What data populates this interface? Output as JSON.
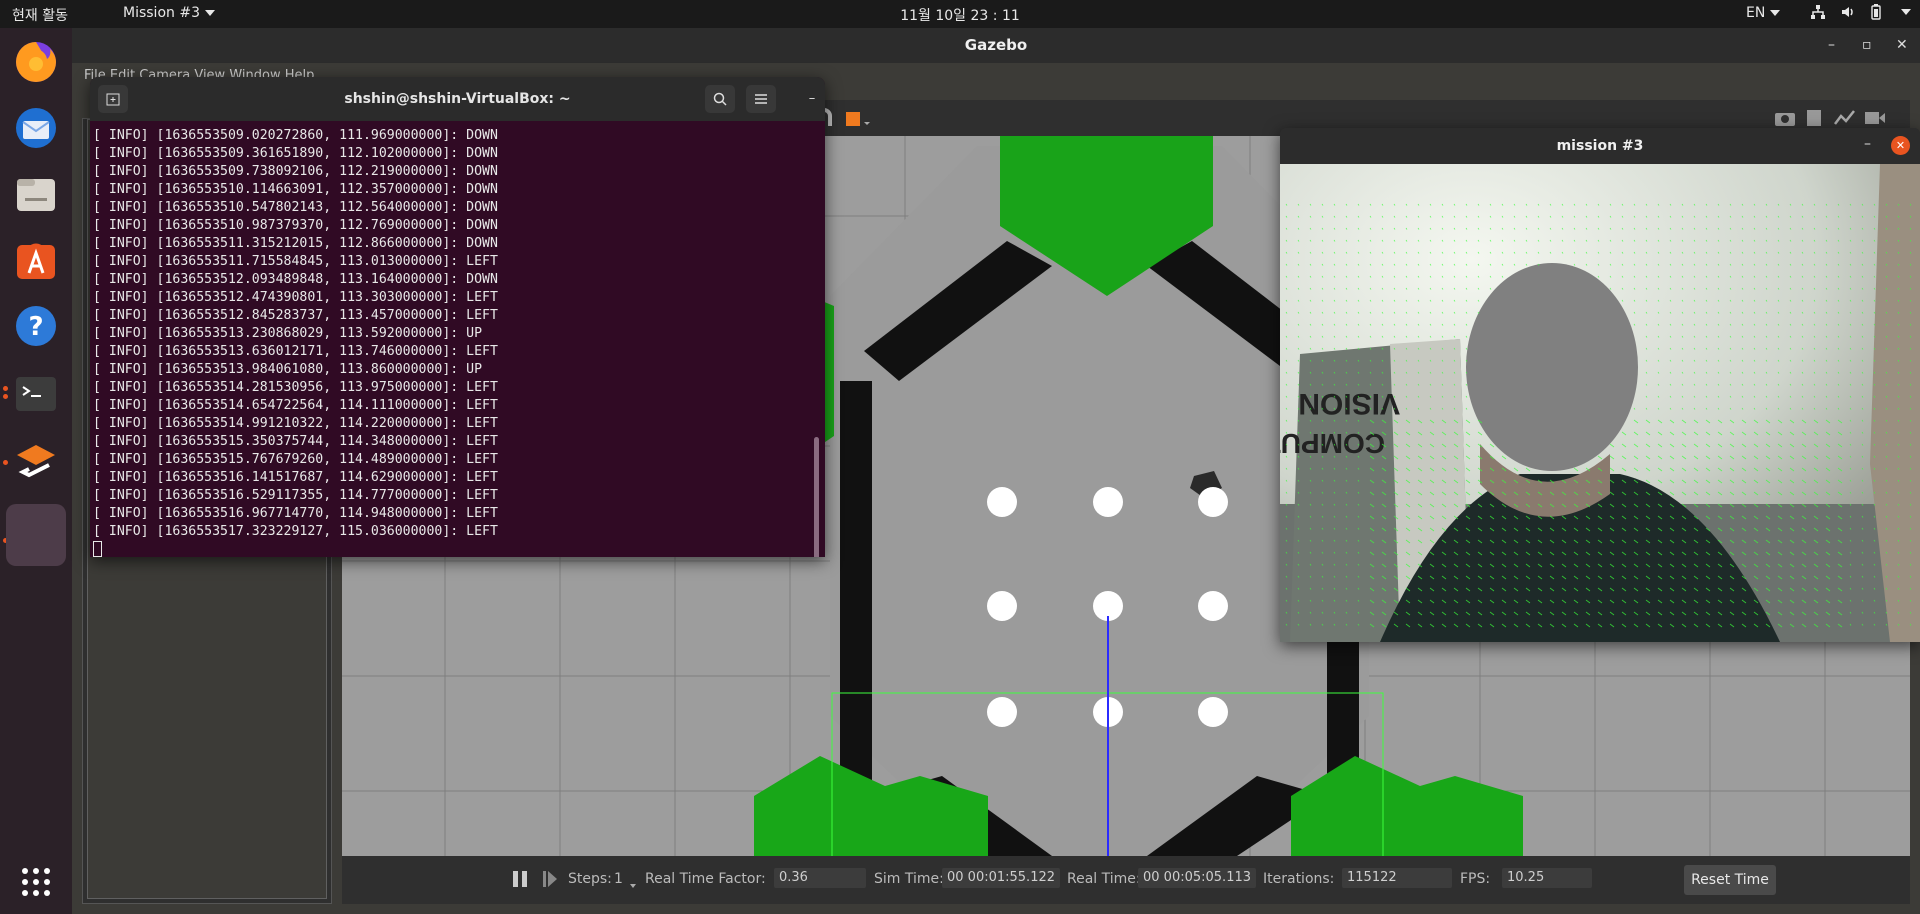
{
  "topbar": {
    "activities": "현재 활동",
    "app_menu": "Mission #3",
    "clock": "11월 10일  23 : 11",
    "lang": "EN",
    "tray_icons": [
      "network-icon",
      "volume-icon",
      "battery-icon"
    ]
  },
  "dock": {
    "items": [
      "firefox-icon",
      "thunderbird-icon",
      "files-icon",
      "software-icon",
      "help-icon",
      "terminal-icon",
      "layers-icon",
      "active-window-icon"
    ],
    "apps_grid": "apps-grid-icon"
  },
  "gazebo": {
    "title": "Gazebo",
    "menubar": "File  Edit  Camera  View  Window  Help",
    "bottom": {
      "steps_label": "Steps:",
      "steps_value": "1",
      "rtf_label": "Real Time Factor:",
      "rtf_value": "0.36",
      "sim_label": "Sim Time:",
      "sim_value": "00 00:01:55.122",
      "real_label": "Real Time:",
      "real_value": "00 00:05:05.113",
      "iter_label": "Iterations:",
      "iter_value": "115122",
      "fps_label": "FPS:",
      "fps_value": "10.25",
      "reset_label": "Reset Time"
    }
  },
  "terminal": {
    "title": "shshin@shshin-VirtualBox: ~",
    "lines": [
      "[ INFO] [1636553509.020272860, 111.969000000]: DOWN",
      "[ INFO] [1636553509.361651890, 112.102000000]: DOWN",
      "[ INFO] [1636553509.738092106, 112.219000000]: DOWN",
      "[ INFO] [1636553510.114663091, 112.357000000]: DOWN",
      "[ INFO] [1636553510.547802143, 112.564000000]: DOWN",
      "[ INFO] [1636553510.987379370, 112.769000000]: DOWN",
      "[ INFO] [1636553511.315212015, 112.866000000]: DOWN",
      "[ INFO] [1636553511.715584845, 113.013000000]: LEFT",
      "[ INFO] [1636553512.093489848, 113.164000000]: DOWN",
      "[ INFO] [1636553512.474390801, 113.303000000]: LEFT",
      "[ INFO] [1636553512.845283737, 113.457000000]: LEFT",
      "[ INFO] [1636553513.230868029, 113.592000000]: UP",
      "[ INFO] [1636553513.636012171, 113.746000000]: LEFT",
      "[ INFO] [1636553513.984061080, 113.860000000]: UP",
      "[ INFO] [1636553514.281530956, 113.975000000]: LEFT",
      "[ INFO] [1636553514.654722564, 114.111000000]: LEFT",
      "[ INFO] [1636553514.991210322, 114.220000000]: LEFT",
      "[ INFO] [1636553515.350375744, 114.348000000]: LEFT",
      "[ INFO] [1636553515.767679260, 114.489000000]: LEFT",
      "[ INFO] [1636553516.141517687, 114.629000000]: LEFT",
      "[ INFO] [1636553516.529117355, 114.777000000]: LEFT",
      "[ INFO] [1636553516.967714770, 114.948000000]: LEFT",
      "[ INFO] [1636553517.323229127, 115.036000000]: LEFT"
    ]
  },
  "camera_window": {
    "title": "mission #3",
    "book_text_1": "VISION",
    "book_text_2": "COMPUTER"
  },
  "colors": {
    "accent": "#e95420",
    "terminal_bg": "#300a24",
    "hex_green": "#19a319",
    "flow_green": "#39ff39"
  }
}
